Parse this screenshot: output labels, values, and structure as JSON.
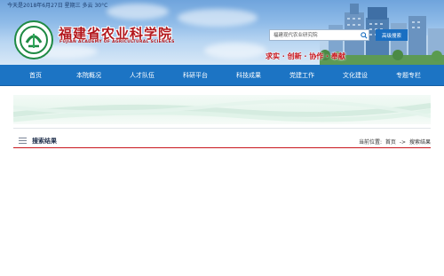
{
  "header": {
    "date_weather": "今天是2018年6月27日 星期三 多云 30°C",
    "site_title": "福建省农业科学院",
    "site_subtitle": "FUJIAN ACADEMY OF AGRICULTURAL SCIENCES",
    "slogan": "求实 · 创新 · 协作 · 奉献",
    "search": {
      "value": "福建现代农业研究院"
    },
    "advanced_search_label": "高级搜索"
  },
  "nav": {
    "items": [
      "首页",
      "本院概况",
      "人才队伍",
      "科研平台",
      "科技成果",
      "党建工作",
      "文化建设",
      "专题专栏"
    ]
  },
  "main": {
    "section_title": "搜索结果",
    "breadcrumb": {
      "prefix": "当前位置:",
      "home": "首页",
      "sep": "->",
      "current": "搜索结果"
    }
  },
  "colors": {
    "nav_bg": "#1c74c4",
    "title_red": "#b3161b",
    "accent_red": "#c9161d",
    "adv_button": "#1a6fc2"
  },
  "icons": [
    "logo-emblem-icon",
    "search-icon",
    "list-icon"
  ]
}
